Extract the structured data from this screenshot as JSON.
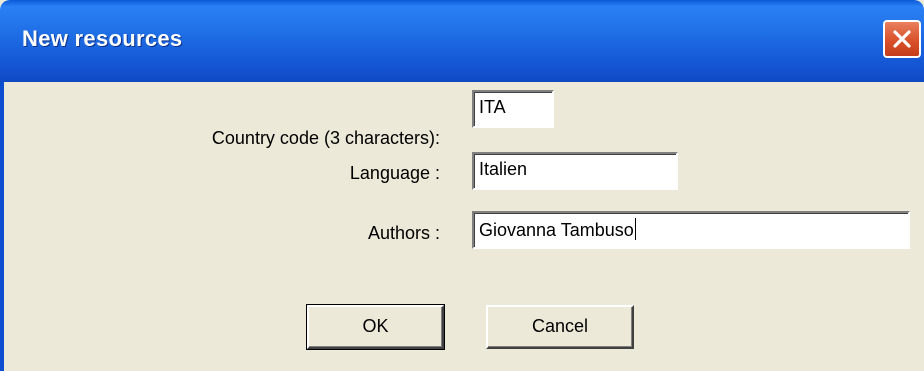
{
  "window": {
    "title": "New resources",
    "close_icon": "close-icon"
  },
  "form": {
    "country_code_label": "Country code (3 characters):",
    "country_code_value": "ITA",
    "language_label": "Language :",
    "language_value": "Italien",
    "authors_label": "Authors :",
    "authors_value": "Giovanna Tambuso"
  },
  "buttons": {
    "ok_label": "OK",
    "cancel_label": "Cancel"
  },
  "colors": {
    "titlebar": "#1f6fe6",
    "dialog_background": "#ece9d8",
    "close_button": "#d9512a"
  }
}
